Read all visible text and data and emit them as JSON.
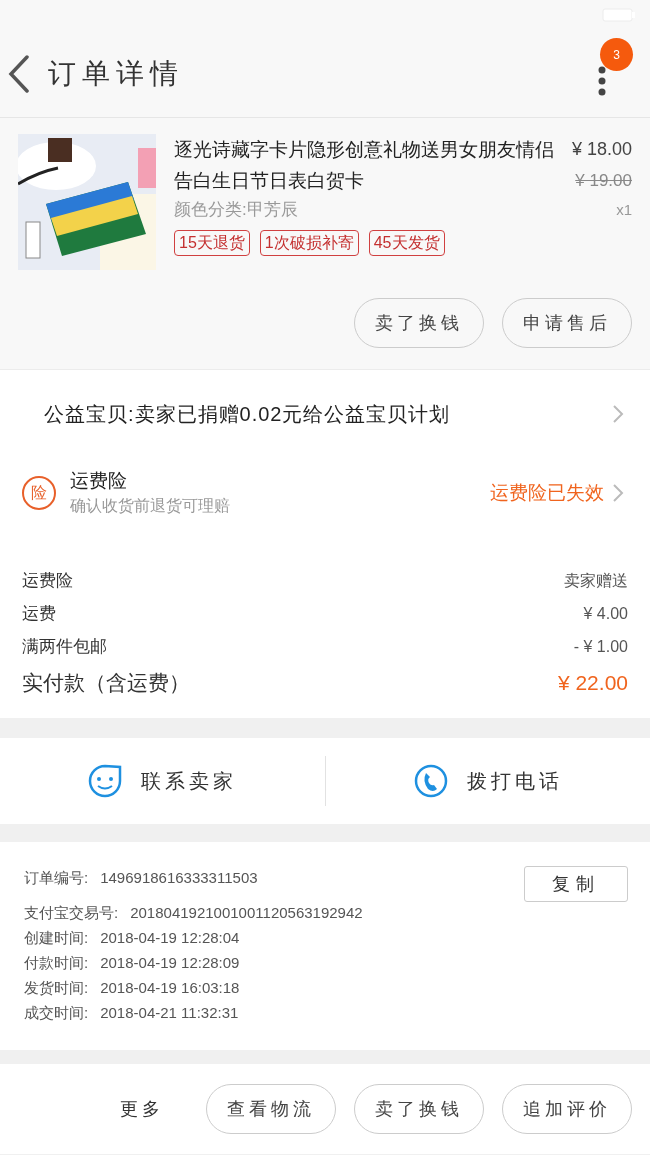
{
  "header": {
    "title": "订单详情",
    "badge": "3"
  },
  "product": {
    "title": "逐光诗藏字卡片隐形创意礼物送男女朋友情侣告白生日节日表白贺卡",
    "variant": "颜色分类:甲芳辰",
    "price": "¥ 18.00",
    "original_price": "¥ 19.00",
    "quantity": "x1",
    "tags": [
      "15天退货",
      "1次破损补寄",
      "45天发货"
    ],
    "actions": [
      "卖了换钱",
      "申请售后"
    ]
  },
  "charity": {
    "text": "公益宝贝:卖家已捐赠0.02元给公益宝贝计划"
  },
  "insurance": {
    "title": "运费险",
    "subtitle": "确认收货前退货可理赔",
    "status": "运费险已失效",
    "icon_label": "险"
  },
  "fees": [
    {
      "label": "运费险",
      "value": "卖家赠送",
      "kind": "plain"
    },
    {
      "label": "运费",
      "value": "¥ 4.00",
      "kind": "plain"
    },
    {
      "label": "满两件包邮",
      "value": "- ¥ 1.00",
      "kind": "plain"
    },
    {
      "label": "实付款（含运费）",
      "value": "¥ 22.00",
      "kind": "total"
    }
  ],
  "contact": [
    "联系卖家",
    "拨打电话"
  ],
  "order_info": {
    "copy_button": "复制",
    "rows": [
      {
        "label": "订单编号:",
        "value": "1496918616333311503"
      },
      {
        "label": "支付宝交易号:",
        "value": "2018041921001001120563192942"
      },
      {
        "label": "创建时间:",
        "value": "2018-04-19 12:28:04"
      },
      {
        "label": "付款时间:",
        "value": "2018-04-19 12:28:09"
      },
      {
        "label": "发货时间:",
        "value": "2018-04-19 16:03:18"
      },
      {
        "label": "成交时间:",
        "value": "2018-04-21 11:32:31"
      }
    ]
  },
  "bottom_bar": {
    "more": "更多",
    "buttons": [
      "查看物流",
      "卖了换钱",
      "追加评价"
    ]
  }
}
